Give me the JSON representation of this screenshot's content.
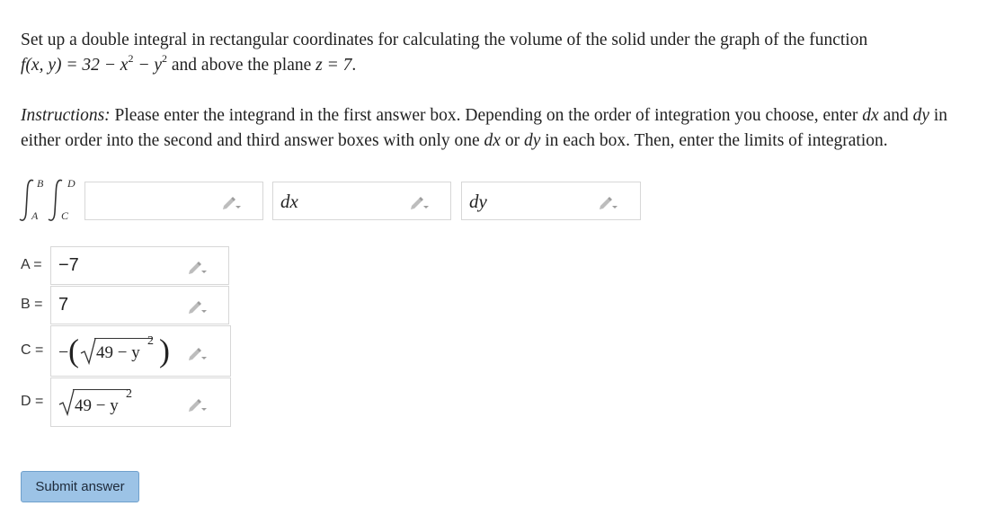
{
  "problem": {
    "line1": "Set up a double integral in rectangular coordinates for calculating the volume of the solid under the graph of the function",
    "func": "f(x, y) = 32 − x",
    "exp1": "2",
    "minus_y": " − y",
    "exp2": "2",
    "tail": " and above the plane ",
    "plane": "z = 7",
    "period": "."
  },
  "instructions": {
    "label": "Instructions:",
    "text1": " Please enter the integrand in the first answer box. Depending on the order of integration you choose, enter ",
    "dx": "dx",
    "and": " and ",
    "dy": "dy",
    "text2": " in either order into the second and third answer boxes with only one ",
    "dx2": "dx",
    "or": " or ",
    "dy2": "dy",
    "text3": " in each box. Then, enter the limits of integration."
  },
  "integral": {
    "upper_outer": "B",
    "lower_outer": "A",
    "upper_inner": "D",
    "lower_inner": "C"
  },
  "answers": {
    "integrand": "",
    "second": "dx",
    "third": "dy"
  },
  "limits": {
    "A_label": "A =",
    "A_value": "−7",
    "B_label": "B =",
    "B_value": "7",
    "C_label": "C =",
    "C_value": "−(√49 − y²)",
    "C_neg": "−",
    "C_rad": "49 − y",
    "C_exp": "2",
    "D_label": "D =",
    "D_value": "√49 − y²",
    "D_rad": "49 − y",
    "D_exp": "2"
  },
  "submit_label": "Submit answer"
}
